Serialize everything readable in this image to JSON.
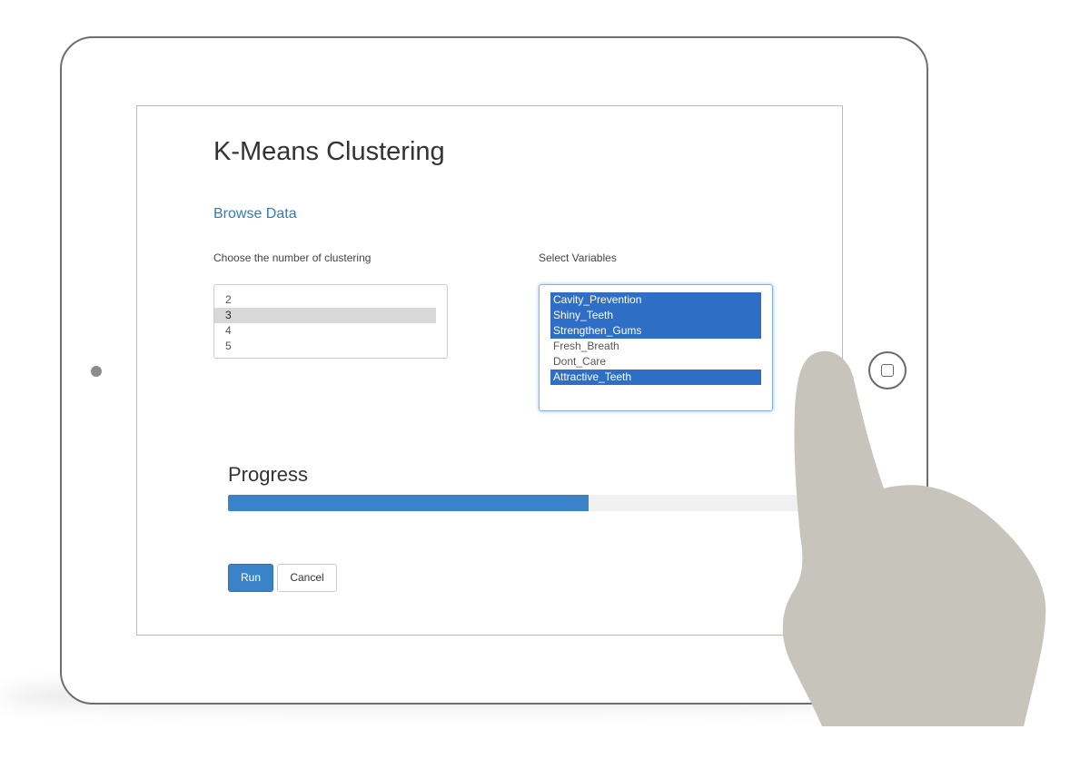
{
  "app": {
    "title": "K-Means Clustering",
    "browse_link": "Browse Data"
  },
  "clusters": {
    "label": "Choose the number of clustering",
    "options": [
      "2",
      "3",
      "4",
      "5"
    ],
    "selected_value": "3"
  },
  "variables": {
    "label": "Select Variables",
    "options": [
      {
        "label": "Cavity_Prevention",
        "selected": true
      },
      {
        "label": "Shiny_Teeth",
        "selected": true
      },
      {
        "label": "Strengthen_Gums",
        "selected": true
      },
      {
        "label": "Fresh_Breath",
        "selected": false
      },
      {
        "label": "Dont_Care",
        "selected": false
      },
      {
        "label": "Attractive_Teeth",
        "selected": true
      }
    ]
  },
  "progress": {
    "label": "Progress",
    "percent": 62
  },
  "buttons": {
    "run": "Run",
    "cancel": "Cancel"
  },
  "colors": {
    "accent": "#3a83c9",
    "selected_variable": "#2e6fc5",
    "link": "#337ab7",
    "hand": "#c7c4bc"
  },
  "icons": {
    "camera": "camera-dot-icon",
    "home": "home-button-icon",
    "hand": "pointing-hand-icon"
  }
}
